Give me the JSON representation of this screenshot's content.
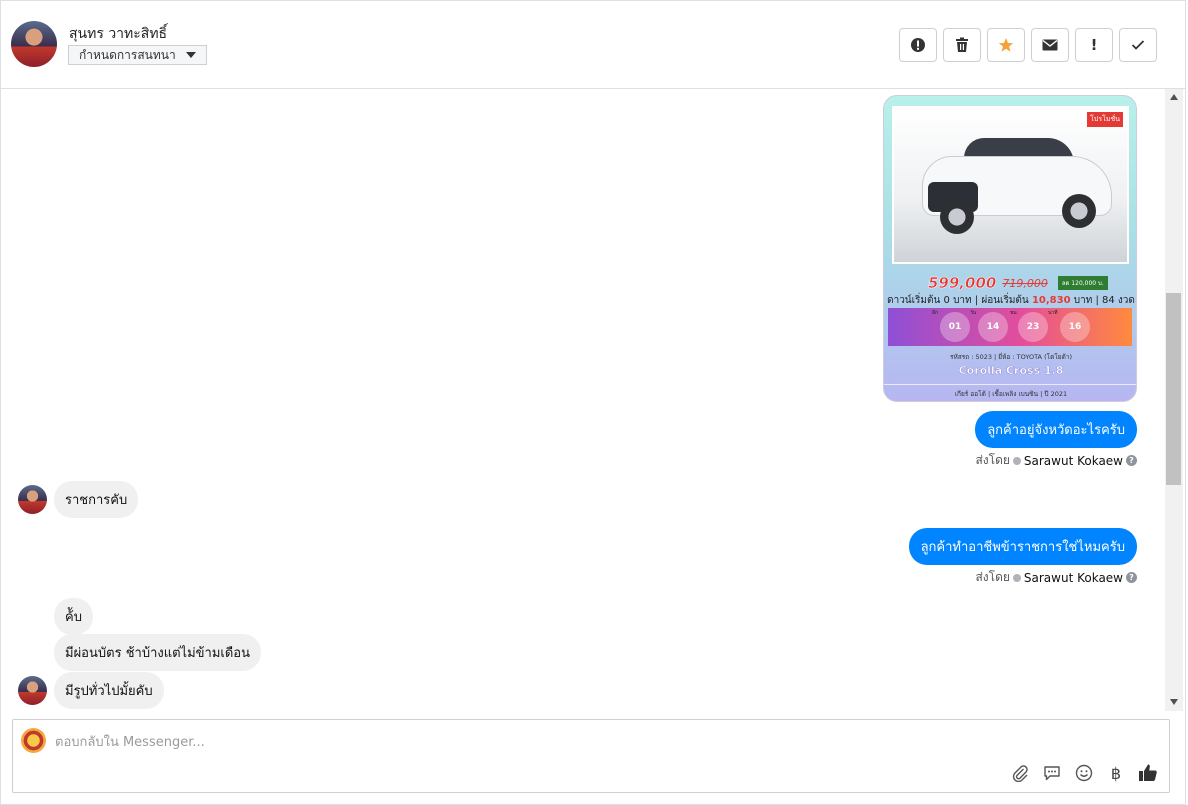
{
  "header": {
    "contact_name": "สุนทร วาทะสิทธิ์",
    "assign_label": "กำหนดการสนทนา",
    "actions": [
      {
        "icon": "alert-circle-icon",
        "label": "!"
      },
      {
        "icon": "trash-icon",
        "label": ""
      },
      {
        "icon": "star-icon",
        "label": ""
      },
      {
        "icon": "mail-icon",
        "label": ""
      },
      {
        "icon": "exclamation-icon",
        "label": "!"
      },
      {
        "icon": "check-icon",
        "label": ""
      }
    ],
    "star_color": "#f4a13a"
  },
  "ad_card": {
    "tag": "โปรโมชั่น",
    "price": "599,000",
    "old_price": "719,000",
    "discount": "ลด 120,000 บ.",
    "down_prefix": "ดาวน์เริ่มต้น 0 บาท | ผ่อนเริ่มต้น ",
    "installment": "10,830",
    "down_suffix": " บาท | 84 งวด",
    "countdown": [
      {
        "label": "อีก",
        "value": "01"
      },
      {
        "label": "วัน",
        "value": "14"
      },
      {
        "label": "ชม.",
        "value": "23"
      },
      {
        "label": "นาที",
        "value": "16"
      }
    ],
    "spec": "รหัสรถ : 5023 | ยี่ห้อ : TOYOTA (โตโยต้า)",
    "model": "Corolla Cross 1.8",
    "footer": "เกียร์ ออโต้  |  เชื้อเพลิง เบนซิน  |  ปี 2021"
  },
  "messages": [
    {
      "side": "out",
      "text": "ลูกค้าอยู่จังหวัดอะไรครับ",
      "sent_by_label": "ส่งโดย",
      "agent": "Sarawut Kokaew"
    },
    {
      "side": "in",
      "text": "ราชการคับ"
    },
    {
      "side": "out",
      "text": "ลูกค้าทำอาชีพข้าราชการใช่ไหมครับ",
      "sent_by_label": "ส่งโดย",
      "agent": "Sarawut Kokaew"
    },
    {
      "side": "in",
      "text": "ค้ับ"
    },
    {
      "side": "in",
      "text": "มีผ่อนบัตร ช้าบ้างแต่ไม่ข้ามเดือน"
    },
    {
      "side": "in",
      "text": "มีรูปทั่วไปมั้ยคับ"
    }
  ],
  "composer": {
    "placeholder": "ตอบกลับใน Messenger...",
    "tools": [
      "paperclip-icon",
      "quick-reply-icon",
      "emoji-icon",
      "baht-icon",
      "thumbs-up-icon"
    ],
    "baht_symbol": "฿"
  },
  "colors": {
    "outgoing_bubble": "#0084ff",
    "incoming_bubble": "#f0f0f0",
    "price_red": "#e53935"
  }
}
